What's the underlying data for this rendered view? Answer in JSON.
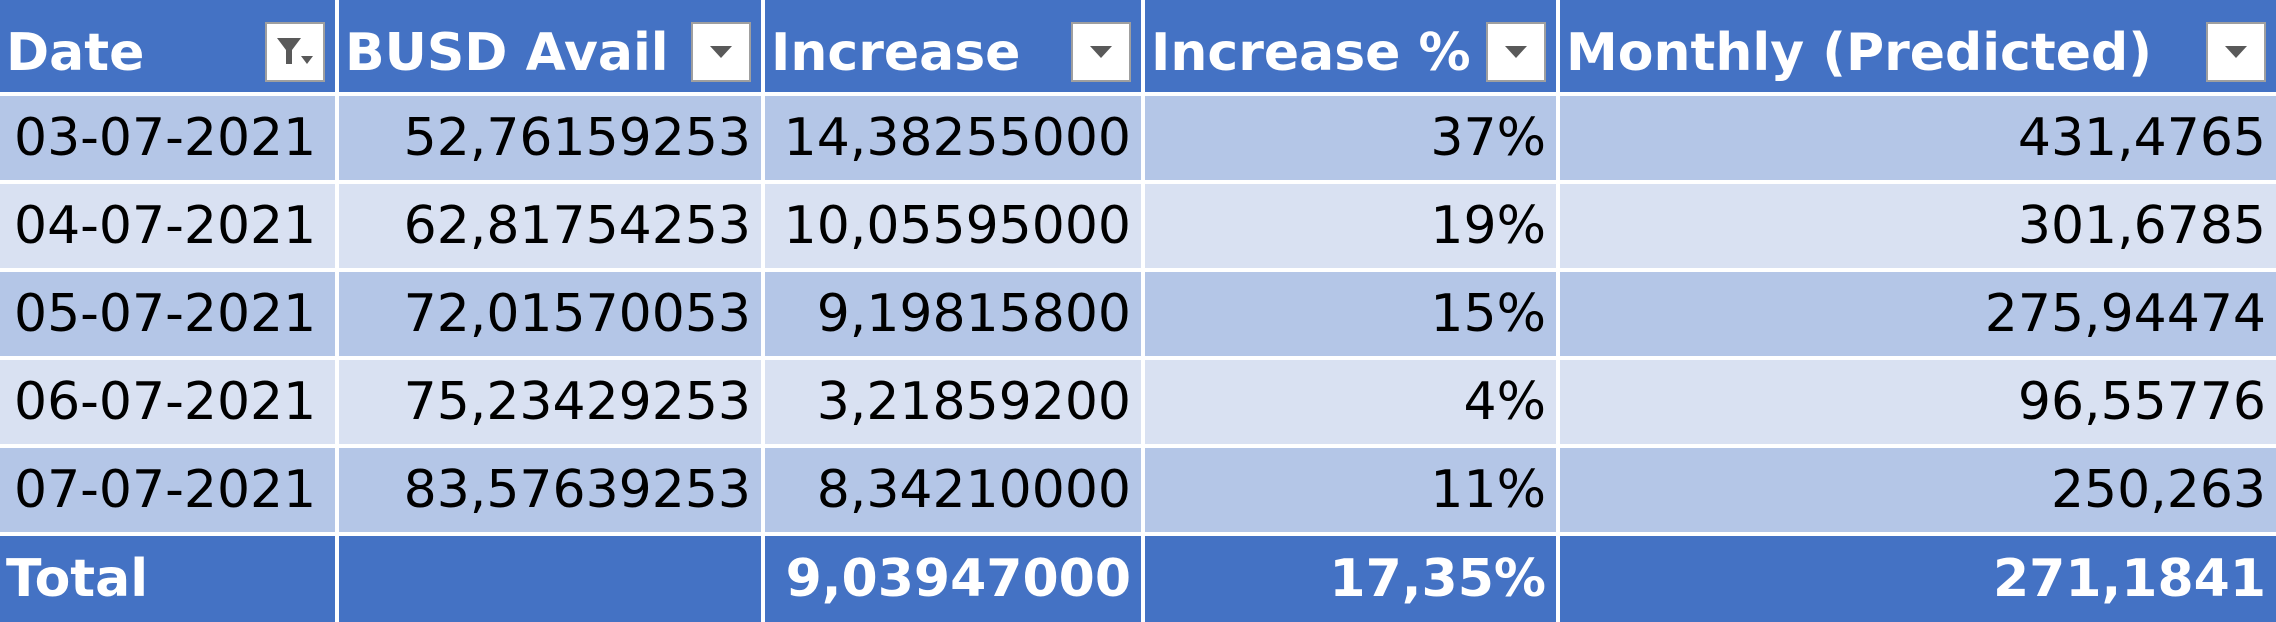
{
  "table": {
    "headers": [
      {
        "label": "Date",
        "filter_state": "filtered",
        "filter_icon": "filter-funnel-icon"
      },
      {
        "label": "BUSD Avail",
        "filter_state": "dropdown",
        "filter_icon": "dropdown-arrow-icon"
      },
      {
        "label": "Increase",
        "filter_state": "dropdown",
        "filter_icon": "dropdown-arrow-icon"
      },
      {
        "label": "Increase %",
        "filter_state": "dropdown",
        "filter_icon": "dropdown-arrow-icon"
      },
      {
        "label": "Monthly (Predicted)",
        "filter_state": "dropdown",
        "filter_icon": "dropdown-arrow-icon"
      }
    ],
    "rows": [
      [
        "03-07-2021",
        "52,76159253",
        "14,38255000",
        "37%",
        "431,4765"
      ],
      [
        "04-07-2021",
        "62,81754253",
        "10,05595000",
        "19%",
        "301,6785"
      ],
      [
        "05-07-2021",
        "72,01570053",
        "9,19815800",
        "15%",
        "275,94474"
      ],
      [
        "06-07-2021",
        "75,23429253",
        "3,21859200",
        "4%",
        "96,55776"
      ],
      [
        "07-07-2021",
        "83,57639253",
        "8,34210000",
        "11%",
        "250,263"
      ]
    ],
    "total": [
      "Total",
      "",
      "9,03947000",
      "17,35%",
      "271,1841"
    ]
  },
  "colors": {
    "header_bg": "#4472c4",
    "band_dark": "#b4c6e7",
    "band_light": "#d9e1f2",
    "header_text": "#ffffff",
    "cell_text": "#000000"
  }
}
